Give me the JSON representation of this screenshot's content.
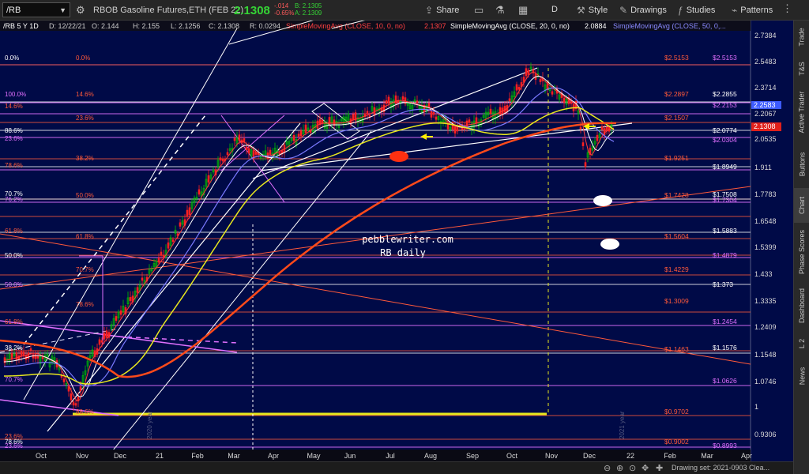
{
  "toolbar": {
    "symbol": "/RB",
    "description": "RBOB Gasoline Futures,ETH (FEB 22)",
    "last_price": "2.1308",
    "change": "-.014",
    "change_pct": "-0.65%",
    "bid": "B: 2.1305",
    "ask": "A: 2.1309",
    "share_label": "Share",
    "period_label": "D",
    "style_label": "Style",
    "drawings_label": "Drawings",
    "studies_label": "Studies",
    "patterns_label": "Patterns"
  },
  "info_bar": {
    "title": "/RB 5 Y 1D",
    "date": "D: 12/22/21",
    "open": "O: 2.144",
    "high": "H: 2.155",
    "low": "L: 2.1256",
    "close": "C: 2.1308",
    "range": "R: 0.0294",
    "sma10_label": "SimpleMovingAvg (CLOSE, 10, 0, no)",
    "sma10_value": "2.1307",
    "sma20_label": "SimpleMovingAvg (CLOSE, 20, 0, no)",
    "sma20_value": "2.0884",
    "sma50_label": "SimpleMovingAvg (CLOSE, 50, 0,..."
  },
  "right_tabs": [
    "Trade",
    "T&S",
    "Active Trader",
    "Buttons",
    "Chart",
    "Phase Scores",
    "Dashboard",
    "L 2",
    "News"
  ],
  "right_tab_active": "Chart",
  "price_axis": {
    "ticks": [
      "2.7384",
      "2.5483",
      "2.3714",
      "2.2067",
      "2.0535",
      "1.911",
      "1.7783",
      "1.6548",
      "1.5399",
      "1.433",
      "1.3335",
      "1.2409",
      "1.1548",
      "1.0746",
      "1",
      "0.9306"
    ],
    "badges": [
      {
        "value": "2.2583",
        "color": "#3d5bff"
      },
      {
        "value": "2.1308",
        "color": "#e0201b"
      }
    ]
  },
  "x_axis": {
    "labels": [
      "Oct",
      "Nov",
      "Dec",
      "21",
      "Feb",
      "Mar",
      "Apr",
      "May",
      "Jun",
      "Jul",
      "Aug",
      "Sep",
      "Oct",
      "Nov",
      "Dec",
      "22",
      "Feb",
      "Mar",
      "Apr"
    ]
  },
  "fib_left_outer": [
    "0.0%",
    "100.0%",
    "14.6%",
    "88.6%",
    "23.6%",
    "78.6%",
    "70.7%",
    "76.2%",
    "61.8%",
    "50.0%",
    "50.0%",
    "61.8%",
    "38.2%",
    "70.7%",
    "23.6%",
    "78.6%",
    "23.6%"
  ],
  "fib_left_inner": [
    "0.0%",
    "14.6%",
    "23.6%",
    "38.2%",
    "50.0%",
    "61.8%",
    "70.7%",
    "78.6%",
    "88.6%"
  ],
  "fib_right_red": [
    "$2.5153",
    "$2.2897",
    "$2.1507",
    "$1.9251",
    "$1.7428",
    "$1.5604",
    "$1.4229",
    "$1.3009",
    "$1.1463",
    "$0.9702",
    "$0.9002"
  ],
  "fib_right_purple": [
    "$2.5153",
    "$2.2153",
    "$2.0304",
    "$1.7304",
    "$1.4879",
    "$1.2454",
    "$1.0626",
    "$0.8993"
  ],
  "fib_right_white": [
    "$2.2855",
    "$2.0774",
    "$1.8949",
    "$1.7508",
    "$1.5883",
    "$1.373",
    "$1.1576"
  ],
  "watermark": {
    "line1": "pebblewriter.com",
    "line2": "RB daily"
  },
  "year_labels": [
    "2020 year",
    "2021 year"
  ],
  "bottom": {
    "drawing_set": "Drawing set: 2021-0903 Clea..."
  },
  "colors": {
    "chart_bg": "#000a47",
    "sma10": "#ff3b3b",
    "sma20": "#ffffff",
    "sma50": "#7a7aff",
    "sma100": "#e8e81e",
    "sma200": "#ff4a1a",
    "up_candle": "#00c000",
    "down_candle": "#ff2020",
    "fib_purple": "#e070ff",
    "fib_red": "#ff5a3a"
  }
}
